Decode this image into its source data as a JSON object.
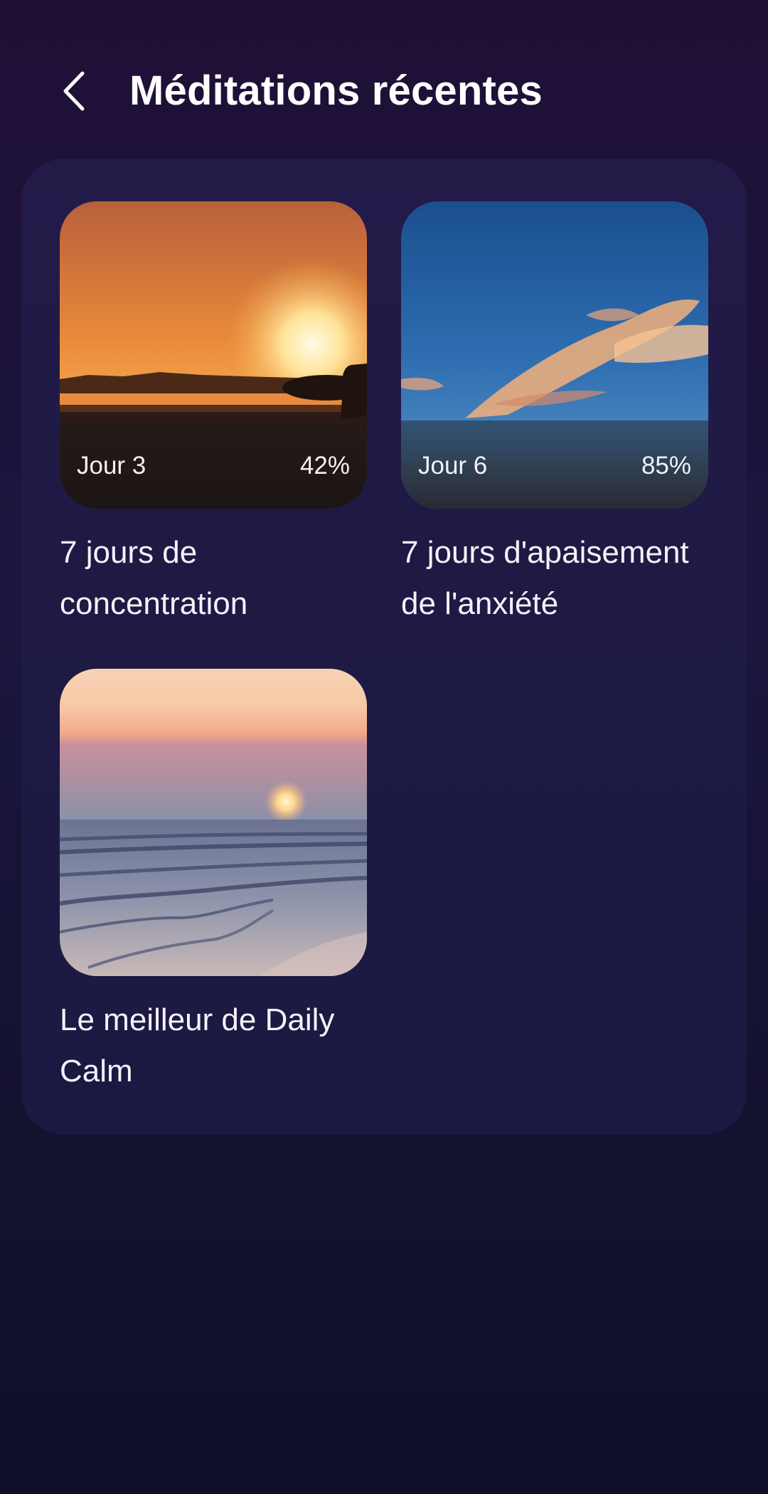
{
  "header": {
    "title": "Méditations récentes",
    "back_icon": "chevron-left-icon"
  },
  "cards": [
    {
      "day": "Jour 3",
      "progress": "42%",
      "title": "7 jours de concentration",
      "image": "sunset-surfer-beach"
    },
    {
      "day": "Jour 6",
      "progress": "85%",
      "title": "7 jours d'apaisement de l'anxiété",
      "image": "sky-orange-clouds"
    },
    {
      "title": "Le meilleur de Daily Calm",
      "image": "sunset-ocean-waves"
    }
  ],
  "colors": {
    "background_top": "#1f0f35",
    "background_bottom": "#0f0e2a",
    "panel": "#1d1a43",
    "text": "#ffffff"
  }
}
